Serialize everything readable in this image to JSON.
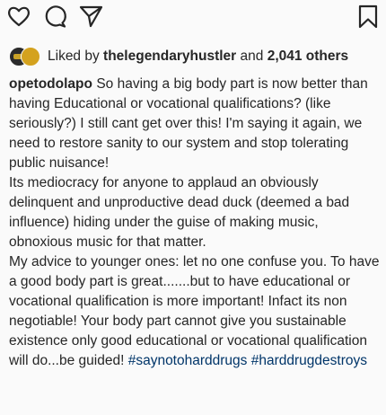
{
  "actions": {
    "icons": [
      "heart-icon",
      "comment-icon",
      "share-icon",
      "bookmark-icon"
    ]
  },
  "likes": {
    "prefix": "Liked by",
    "user": "thelegendaryhustler",
    "conjunction": "and",
    "others": "2,041 others"
  },
  "caption": {
    "username": "opetodolapo",
    "paragraph_1": "So having a big body part is now better than having Educational or vocational qualifications? (like seriously?) I still cant get over this! I'm saying it again, we need to restore sanity to our system and stop tolerating public nuisance!",
    "paragraph_2": "Its mediocracy for anyone  to applaud an obviously delinquent and unproductive dead duck (deemed a bad influence) hiding under the guise of making music, obnoxious music for that matter.",
    "paragraph_3": "My advice to younger ones: let no one confuse you. To have a good body part is great.......but to have educational or vocational qualification is more important! Infact its non negotiable! Your body part cannot give you sustainable existence only good educational or vocational qualification will do...be guided!",
    "hashtag_1": "#saynotoharddrugs",
    "hashtag_2": "#harddrugdestroys"
  },
  "colors": {
    "background": "#fafafa",
    "text": "#262626",
    "hashtag": "#003569"
  }
}
